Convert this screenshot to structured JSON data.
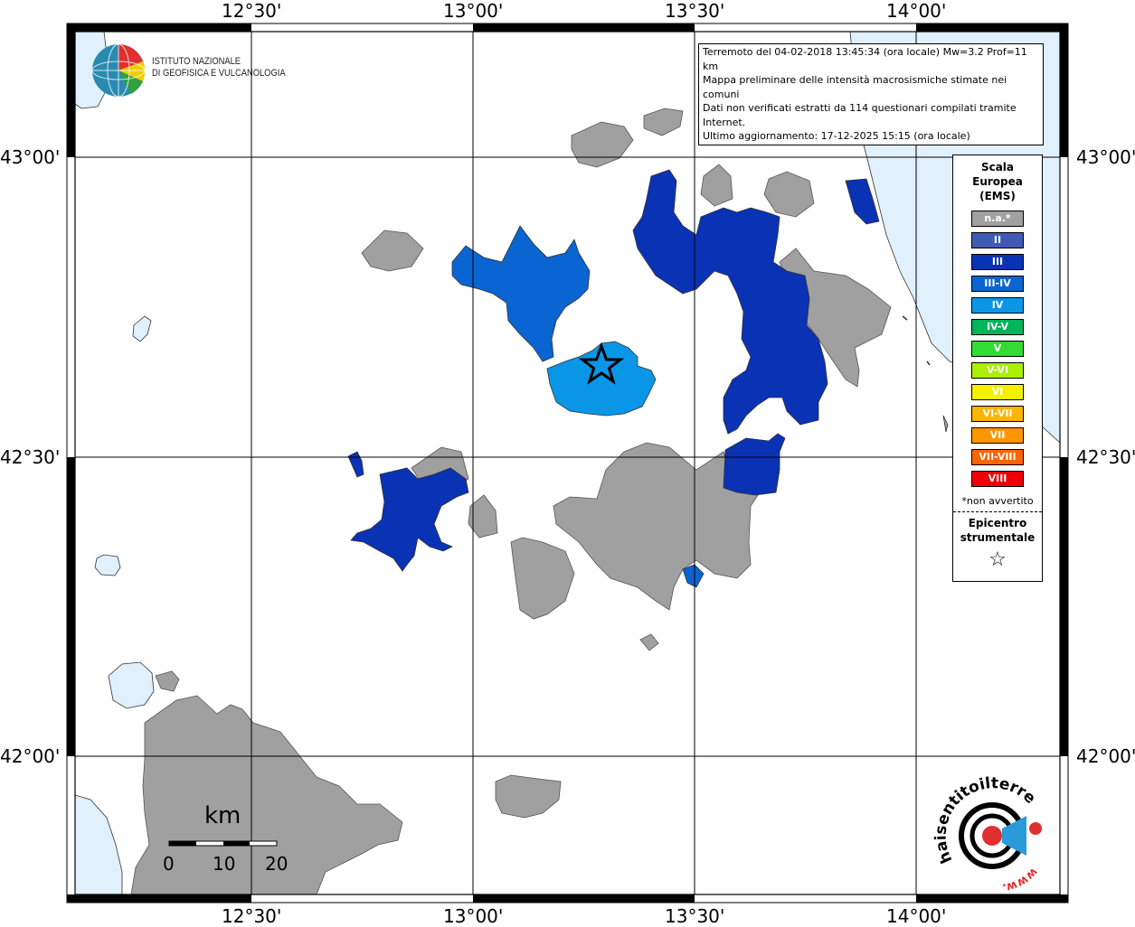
{
  "map": {
    "lon_labels": [
      "12°30'",
      "13°00'",
      "13°30'",
      "14°00'"
    ],
    "lat_labels": [
      "43°00'",
      "42°30'",
      "42°00'"
    ],
    "epicenter_marker": "star-icon"
  },
  "info": {
    "line1": "Terremoto del 04-02-2018 13:45:34 (ora locale) Mw=3.2 Prof=11 km",
    "line2": "Mappa preliminare delle intensità macrosismiche stimate nei comuni",
    "line3": "Dati non verificati estratti da 114 questionari compilati tramite Internet.",
    "line4": "Ultimo aggiornamento: 17-12-2025 15:15 (ora locale)"
  },
  "institute": {
    "line1": "ISTITUTO NAZIONALE",
    "line2": "DI GEOFISICA E VULCANOLOGIA"
  },
  "legend": {
    "title_line1": "Scala",
    "title_line2": "Europea",
    "title_line3": "(EMS)",
    "items": [
      {
        "label": "n.a.*",
        "color": "#a0a0a0"
      },
      {
        "label": "II",
        "color": "#3f5ab0"
      },
      {
        "label": "III",
        "color": "#0a32b4"
      },
      {
        "label": "III-IV",
        "color": "#0a64d2"
      },
      {
        "label": "IV",
        "color": "#0a96e6"
      },
      {
        "label": "IV-V",
        "color": "#00b45a"
      },
      {
        "label": "V",
        "color": "#32dc32"
      },
      {
        "label": "V-VI",
        "color": "#aaf000"
      },
      {
        "label": "VI",
        "color": "#f5f000"
      },
      {
        "label": "VI-VII",
        "color": "#ffb400"
      },
      {
        "label": "VII",
        "color": "#ff9600"
      },
      {
        "label": "VII-VIII",
        "color": "#ff6400"
      },
      {
        "label": "VIII",
        "color": "#f00000"
      }
    ],
    "note": "*non avvertito",
    "epicenter_line1": "Epicentro",
    "epicenter_line2": "strumentale"
  },
  "scalebar": {
    "unit": "km",
    "ticks": [
      "0",
      "10",
      "20"
    ]
  },
  "logo": {
    "text": "haisentitoilterremoto.it",
    "www": "www."
  },
  "colors": {
    "sea": "#e0f0fc",
    "na": "#a0a0a0",
    "III": "#0a32b4",
    "III-IV": "#0a64d2",
    "IV": "#0a96e6"
  }
}
